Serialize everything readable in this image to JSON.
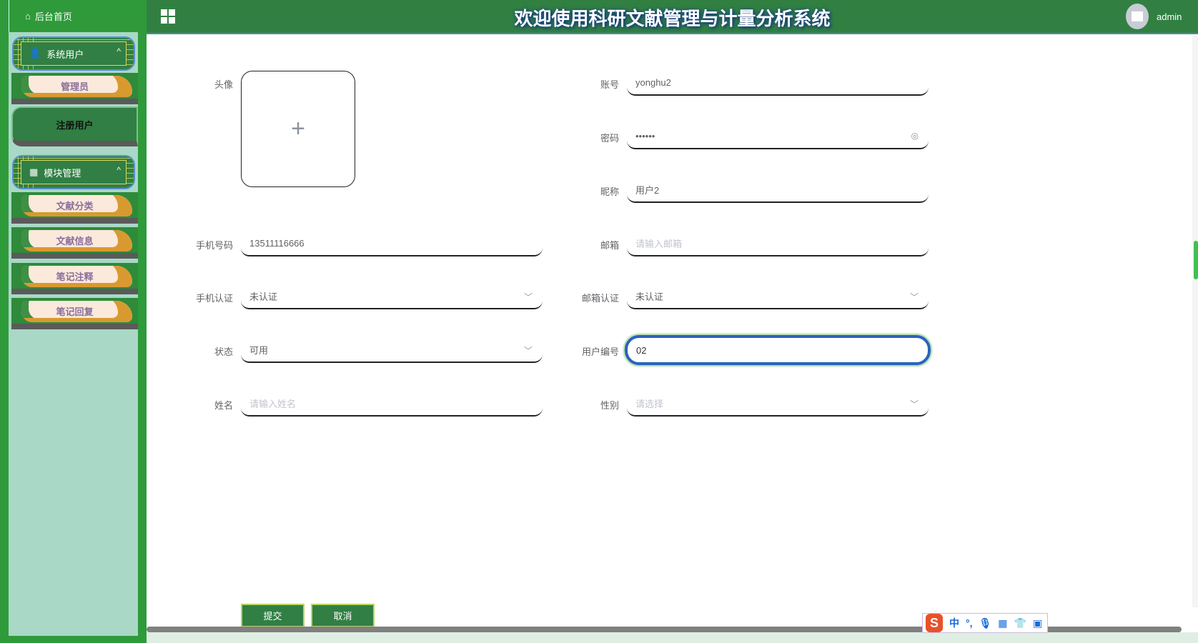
{
  "sidebar": {
    "home": "后台首页",
    "groups": [
      {
        "label": "系统用户",
        "items": [
          "管理员",
          "注册用户"
        ]
      },
      {
        "label": "模块管理",
        "items": [
          "文献分类",
          "文献信息",
          "笔记注释",
          "笔记回复"
        ]
      }
    ]
  },
  "header": {
    "title": "欢迎使用科研文献管理与计量分析系统",
    "user": "admin"
  },
  "form": {
    "avatar_label": "头像",
    "account": {
      "label": "账号",
      "value": "yonghu2"
    },
    "password": {
      "label": "密码",
      "value": "••••••"
    },
    "nickname": {
      "label": "昵称",
      "value": "用户2"
    },
    "phone": {
      "label": "手机号码",
      "value": "13511116666"
    },
    "email": {
      "label": "邮箱",
      "placeholder": "请输入邮箱"
    },
    "phone_verify": {
      "label": "手机认证",
      "value": "未认证"
    },
    "email_verify": {
      "label": "邮箱认证",
      "value": "未认证"
    },
    "status": {
      "label": "状态",
      "value": "可用"
    },
    "user_no": {
      "label": "用户编号",
      "value": "02"
    },
    "name": {
      "label": "姓名",
      "placeholder": "请输入姓名"
    },
    "gender": {
      "label": "性别",
      "placeholder": "请选择"
    },
    "submit": "提交",
    "cancel": "取消"
  },
  "ime": {
    "mode": "中",
    "punct": "°,"
  }
}
